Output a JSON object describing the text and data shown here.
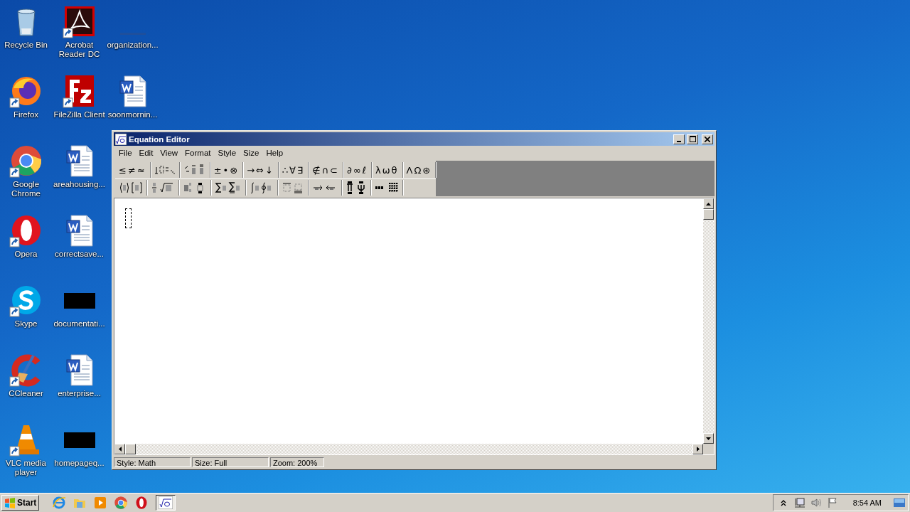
{
  "desktop": {
    "icons": [
      {
        "label": "Recycle Bin",
        "kind": "recycle",
        "shortcut": false
      },
      {
        "label": "Firefox",
        "kind": "firefox",
        "shortcut": true
      },
      {
        "label": "Google Chrome",
        "kind": "chrome",
        "shortcut": true
      },
      {
        "label": "Opera",
        "kind": "opera",
        "shortcut": true
      },
      {
        "label": "Skype",
        "kind": "skype",
        "shortcut": true
      },
      {
        "label": "CCleaner",
        "kind": "ccleaner",
        "shortcut": true
      },
      {
        "label": "VLC media player",
        "kind": "vlc",
        "shortcut": true
      },
      {
        "label": "Acrobat Reader DC",
        "kind": "pdf",
        "shortcut": true
      },
      {
        "label": "FileZilla Client",
        "kind": "filezilla",
        "shortcut": true
      },
      {
        "label": "areahousing...",
        "kind": "word",
        "shortcut": false
      },
      {
        "label": "correctsave...",
        "kind": "word",
        "shortcut": false
      },
      {
        "label": "documentati...",
        "kind": "black",
        "shortcut": false
      },
      {
        "label": "enterprise...",
        "kind": "word",
        "shortcut": false
      },
      {
        "label": "homepageq...",
        "kind": "black",
        "shortcut": false
      },
      {
        "label": "organization...",
        "kind": "blank",
        "shortcut": false
      },
      {
        "label": "soonmornin...",
        "kind": "word",
        "shortcut": false
      }
    ]
  },
  "window": {
    "title": "Equation Editor",
    "menu": [
      "File",
      "Edit",
      "View",
      "Format",
      "Style",
      "Size",
      "Help"
    ],
    "toolbar": {
      "rows": [
        [
          {
            "kind": "symbols",
            "label": "≤≠≈"
          },
          {
            "kind": "template"
          },
          {
            "kind": "template"
          },
          {
            "kind": "symbols",
            "label": "±•⊗"
          },
          {
            "kind": "symbols",
            "label": "→⇔↓"
          },
          {
            "kind": "symbols",
            "label": "∴∀∃"
          },
          {
            "kind": "symbols",
            "label": "∉∩⊂"
          },
          {
            "kind": "symbols",
            "label": "∂∞ℓ"
          },
          {
            "kind": "symbols",
            "label": "λωθ"
          },
          {
            "kind": "symbols",
            "label": "ΛΩ⊛"
          }
        ],
        [
          {
            "kind": "template"
          },
          {
            "kind": "template"
          },
          {
            "kind": "template"
          },
          {
            "kind": "template"
          },
          {
            "kind": "template"
          },
          {
            "kind": "template"
          },
          {
            "kind": "template"
          },
          {
            "kind": "template"
          },
          {
            "kind": "template"
          }
        ]
      ]
    },
    "status_bar": [
      "Style: Math",
      "Size: Full",
      "Zoom: 200%"
    ]
  },
  "taskbar": {
    "start": "Start",
    "clock": "8:54 AM"
  }
}
